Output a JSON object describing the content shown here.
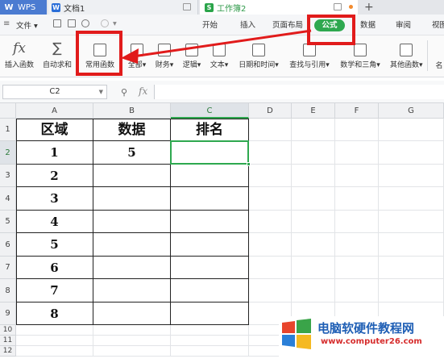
{
  "tabs": {
    "wps": "WPS",
    "doc": "文档1",
    "sheet": "工作簿2",
    "add": "+"
  },
  "menu": {
    "file": "文件",
    "items": [
      "开始",
      "插入",
      "页面布局",
      "公式",
      "数据",
      "审阅",
      "视图"
    ]
  },
  "ribbon": {
    "insert_function": "插入函数",
    "autosum": "自动求和",
    "common_functions": "常用函数",
    "all": "全部",
    "finance": "财务",
    "logic": "逻辑",
    "text": "文本",
    "datetime": "日期和时间",
    "lookup": "查找与引用",
    "math": "数学和三角",
    "other": "其他函数",
    "name": "名"
  },
  "formula_bar": {
    "name_box": "C2",
    "fx": "fx",
    "value": ""
  },
  "grid": {
    "columns": [
      "A",
      "B",
      "C",
      "D",
      "E",
      "F",
      "G"
    ],
    "rows": [
      "1",
      "2",
      "3",
      "4",
      "5",
      "6",
      "7",
      "8",
      "9",
      "10",
      "11",
      "12"
    ],
    "selected_cell": "C2",
    "headers": [
      "区域",
      "数据",
      "排名"
    ],
    "data": [
      [
        "1",
        "5",
        ""
      ],
      [
        "2",
        "",
        ""
      ],
      [
        "3",
        "",
        ""
      ],
      [
        "4",
        "",
        ""
      ],
      [
        "5",
        "",
        ""
      ],
      [
        "6",
        "",
        ""
      ],
      [
        "7",
        "",
        ""
      ],
      [
        "8",
        "",
        ""
      ]
    ]
  },
  "watermark": {
    "name": "电脑软硬件教程网",
    "url": "www.computer26.com"
  },
  "colors": {
    "accent_green": "#2ea84f",
    "highlight_red": "#e11b1b"
  }
}
